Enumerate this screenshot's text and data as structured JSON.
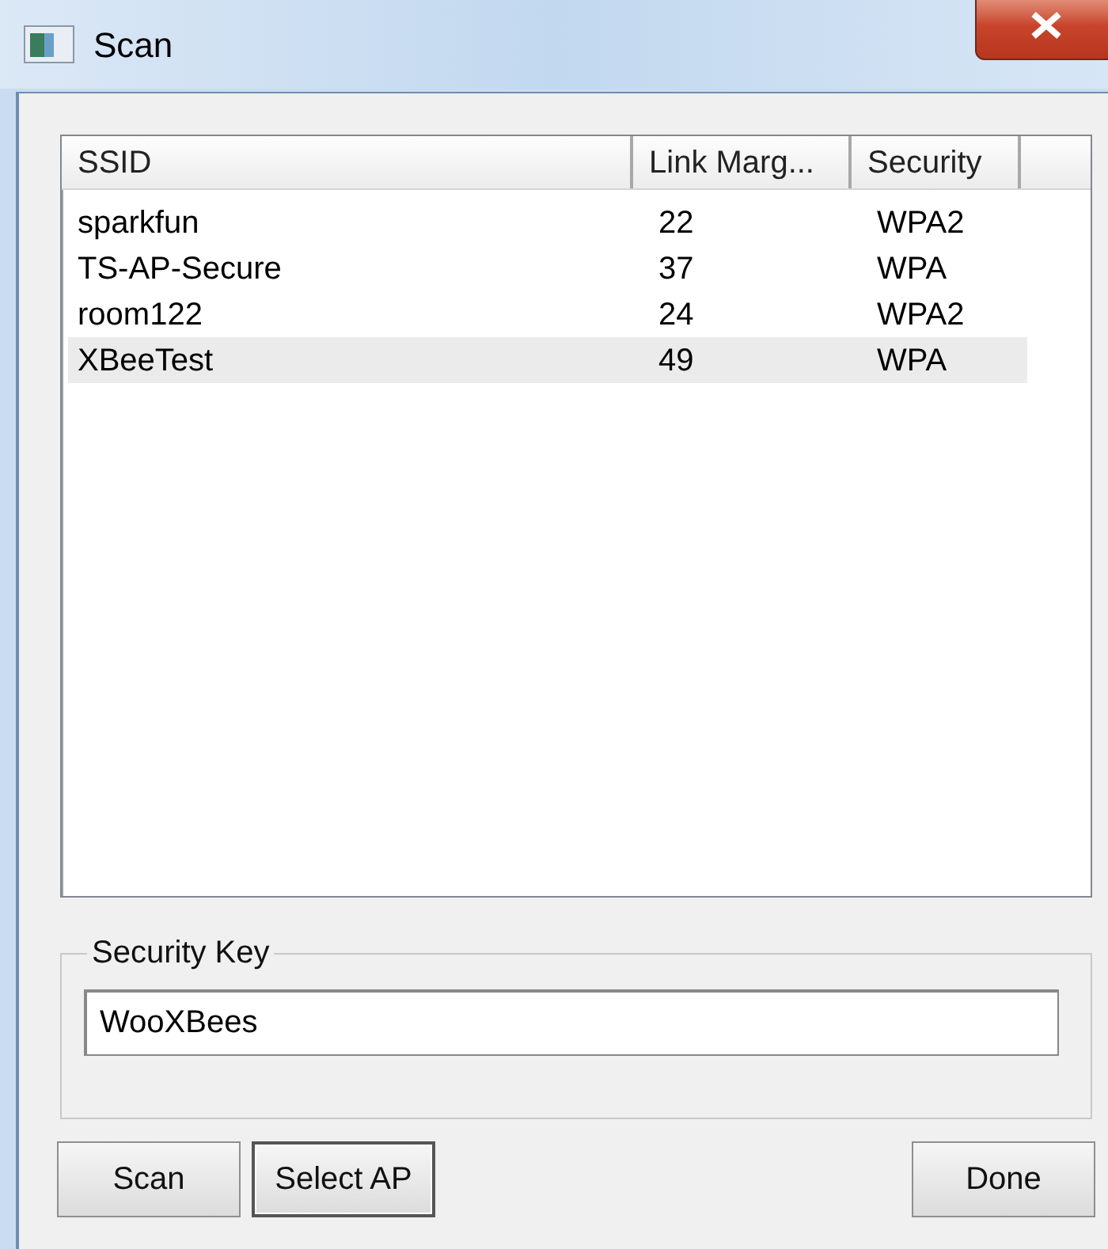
{
  "window": {
    "title": "Scan"
  },
  "table": {
    "columns": [
      "SSID",
      "Link Marg...",
      "Security"
    ],
    "rows": [
      {
        "cells": [
          "sparkfun",
          "22",
          "WPA2"
        ],
        "selected": false
      },
      {
        "cells": [
          "TS-AP-Secure",
          "37",
          "WPA"
        ],
        "selected": false
      },
      {
        "cells": [
          "room122",
          "24",
          "WPA2"
        ],
        "selected": false
      },
      {
        "cells": [
          "XBeeTest",
          "49",
          "WPA"
        ],
        "selected": true
      }
    ]
  },
  "security_key": {
    "label": "Security Key",
    "value": "WooXBees"
  },
  "buttons": [
    {
      "label": "Scan",
      "default": false
    },
    {
      "label": "Select AP",
      "default": true
    },
    {
      "label": "Done",
      "default": false
    }
  ]
}
